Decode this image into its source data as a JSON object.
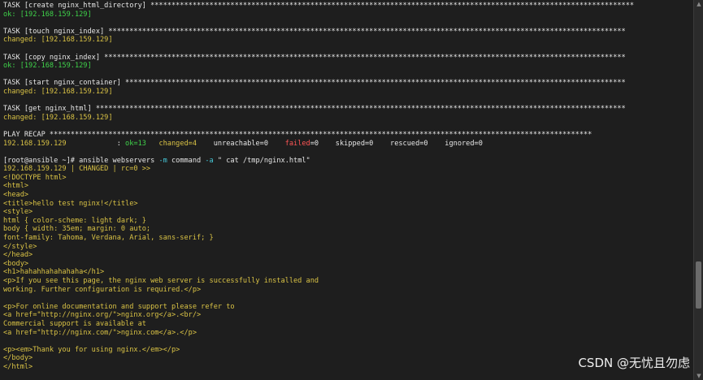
{
  "terminal": {
    "lines": [
      [
        [
          "TASK [create nginx_html_directory] *******************************************************************************************************************",
          "default"
        ]
      ],
      [
        [
          "ok: [192.168.159.129]",
          "green"
        ]
      ],
      [
        [
          "",
          ""
        ]
      ],
      [
        [
          "TASK [touch nginx_index] ***************************************************************************************************************************",
          "default"
        ]
      ],
      [
        [
          "changed: [192.168.159.129]",
          "yellow"
        ]
      ],
      [
        [
          "",
          ""
        ]
      ],
      [
        [
          "TASK [copy nginx_index] ****************************************************************************************************************************",
          "default"
        ]
      ],
      [
        [
          "ok: [192.168.159.129]",
          "green"
        ]
      ],
      [
        [
          "",
          ""
        ]
      ],
      [
        [
          "TASK [start nginx_container] ***********************************************************************************************************************",
          "default"
        ]
      ],
      [
        [
          "changed: [192.168.159.129]",
          "yellow"
        ]
      ],
      [
        [
          "",
          ""
        ]
      ],
      [
        [
          "TASK [get nginx_html] ******************************************************************************************************************************",
          "default"
        ]
      ],
      [
        [
          "changed: [192.168.159.129]",
          "yellow"
        ]
      ],
      [
        [
          "",
          ""
        ]
      ],
      [
        [
          "PLAY RECAP *********************************************************************************************************************************",
          "default"
        ]
      ],
      [
        [
          "192.168.159.129",
          "yellow"
        ],
        [
          "            : ",
          "default"
        ],
        [
          "ok=13",
          "green"
        ],
        [
          "   ",
          "default"
        ],
        [
          "changed=4",
          "yellow"
        ],
        [
          "    unreachable=0    ",
          "default"
        ],
        [
          "failed",
          "red"
        ],
        [
          "=0    skipped=0    rescued=0    ignored=0",
          "default"
        ]
      ],
      [
        [
          "",
          ""
        ]
      ],
      [
        [
          "[root@ansible ~]# ansible webservers ",
          "default"
        ],
        [
          "-m",
          "cyan"
        ],
        [
          " command ",
          "default"
        ],
        [
          "-a",
          "cyan"
        ],
        [
          " \" cat /tmp/nginx.html\"",
          "default"
        ]
      ],
      [
        [
          "192.168.159.129 | CHANGED | rc=0 >>",
          "yellow"
        ]
      ],
      [
        [
          "<!DOCTYPE html>",
          "yellow"
        ]
      ],
      [
        [
          "<html>",
          "yellow"
        ]
      ],
      [
        [
          "<head>",
          "yellow"
        ]
      ],
      [
        [
          "<title>hello test nginx!</title>",
          "yellow"
        ]
      ],
      [
        [
          "<style>",
          "yellow"
        ]
      ],
      [
        [
          "html { color-scheme: light dark; }",
          "yellow"
        ]
      ],
      [
        [
          "body { width: 35em; margin: 0 auto;",
          "yellow"
        ]
      ],
      [
        [
          "font-family: Tahoma, Verdana, Arial, sans-serif; }",
          "yellow"
        ]
      ],
      [
        [
          "</style>",
          "yellow"
        ]
      ],
      [
        [
          "</head>",
          "yellow"
        ]
      ],
      [
        [
          "<body>",
          "yellow"
        ]
      ],
      [
        [
          "<h1>hahahhahahahaha</h1>",
          "yellow"
        ]
      ],
      [
        [
          "<p>If you see this page, the nginx web server is successfully installed and",
          "yellow"
        ]
      ],
      [
        [
          "working. Further configuration is required.</p>",
          "yellow"
        ]
      ],
      [
        [
          "",
          ""
        ]
      ],
      [
        [
          "<p>For online documentation and support please refer to",
          "yellow"
        ]
      ],
      [
        [
          "<a href=\"http://nginx.org/\">nginx.org</a>.<br/>",
          "yellow"
        ]
      ],
      [
        [
          "Commercial support is available at",
          "yellow"
        ]
      ],
      [
        [
          "<a href=\"http://nginx.com/\">nginx.com</a>.</p>",
          "yellow"
        ]
      ],
      [
        [
          "",
          ""
        ]
      ],
      [
        [
          "<p><em>Thank you for using nginx.</em></p>",
          "yellow"
        ]
      ],
      [
        [
          "</body>",
          "yellow"
        ]
      ],
      [
        [
          "</html>",
          "yellow"
        ]
      ]
    ]
  },
  "scrollbar": {
    "up_glyph": "▲",
    "down_glyph": "▼"
  },
  "watermark": {
    "text": "CSDN @无忧且勿虑"
  },
  "colors": {
    "background": "#1e1e1e",
    "default": "#e6e6e6",
    "green": "#3fd24a",
    "yellow": "#d9c245",
    "red": "#ff5555",
    "cyan": "#46c8d8"
  }
}
